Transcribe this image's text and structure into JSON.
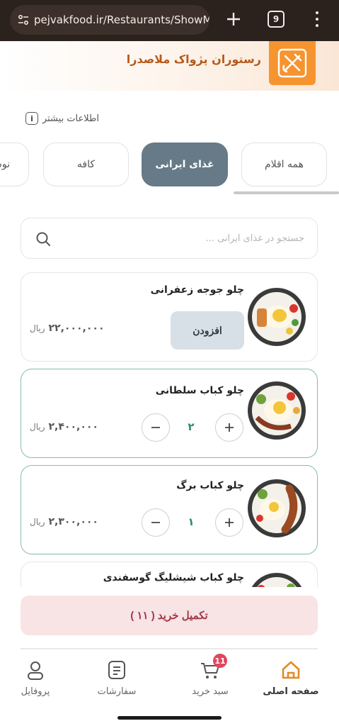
{
  "browser": {
    "url": "pejvakfood.ir/Restaurants/ShowMe",
    "tab_count": "9"
  },
  "restaurant": {
    "name": "رستوران پژواک ملاصدرا",
    "more_info_label": "اطلاعات بیشتر"
  },
  "categories": [
    {
      "label": "همه اقلام",
      "active": false
    },
    {
      "label": "غذای ایرانی",
      "active": true
    },
    {
      "label": "کافه",
      "active": false
    },
    {
      "label": "نوشی",
      "active": false
    }
  ],
  "search": {
    "placeholder": "جستجو در غذای ایرانی ..."
  },
  "products": [
    {
      "name": "چلو جوجه زعفرانی",
      "price": "۲۲,۰۰۰,۰۰۰",
      "unit": "ریال",
      "add_label": "افزودن",
      "quantity": null
    },
    {
      "name": "چلو کباب سلطانی",
      "price": "۲,۴۰۰,۰۰۰",
      "unit": "ریال",
      "quantity": "۲"
    },
    {
      "name": "چلو کباب برگ",
      "price": "۲,۳۰۰,۰۰۰",
      "unit": "ریال",
      "quantity": "۱"
    },
    {
      "name": "چلو کباب شیشلیگ گوسفندی"
    }
  ],
  "checkout": {
    "label": "تکمیل خرید ( ۱۱ )"
  },
  "nav": {
    "home": "صفحه اصلی",
    "cart": "سبد خرید",
    "cart_badge": "11",
    "orders": "سفارشات",
    "profile": "پروفایل"
  },
  "colors": {
    "brand_orange": "#f6942f",
    "active_tab": "#667a88",
    "qty_green": "#2e8a6e",
    "checkout_bg": "#f8e3e5",
    "checkout_text": "#a23a46",
    "badge": "#e0465c"
  }
}
